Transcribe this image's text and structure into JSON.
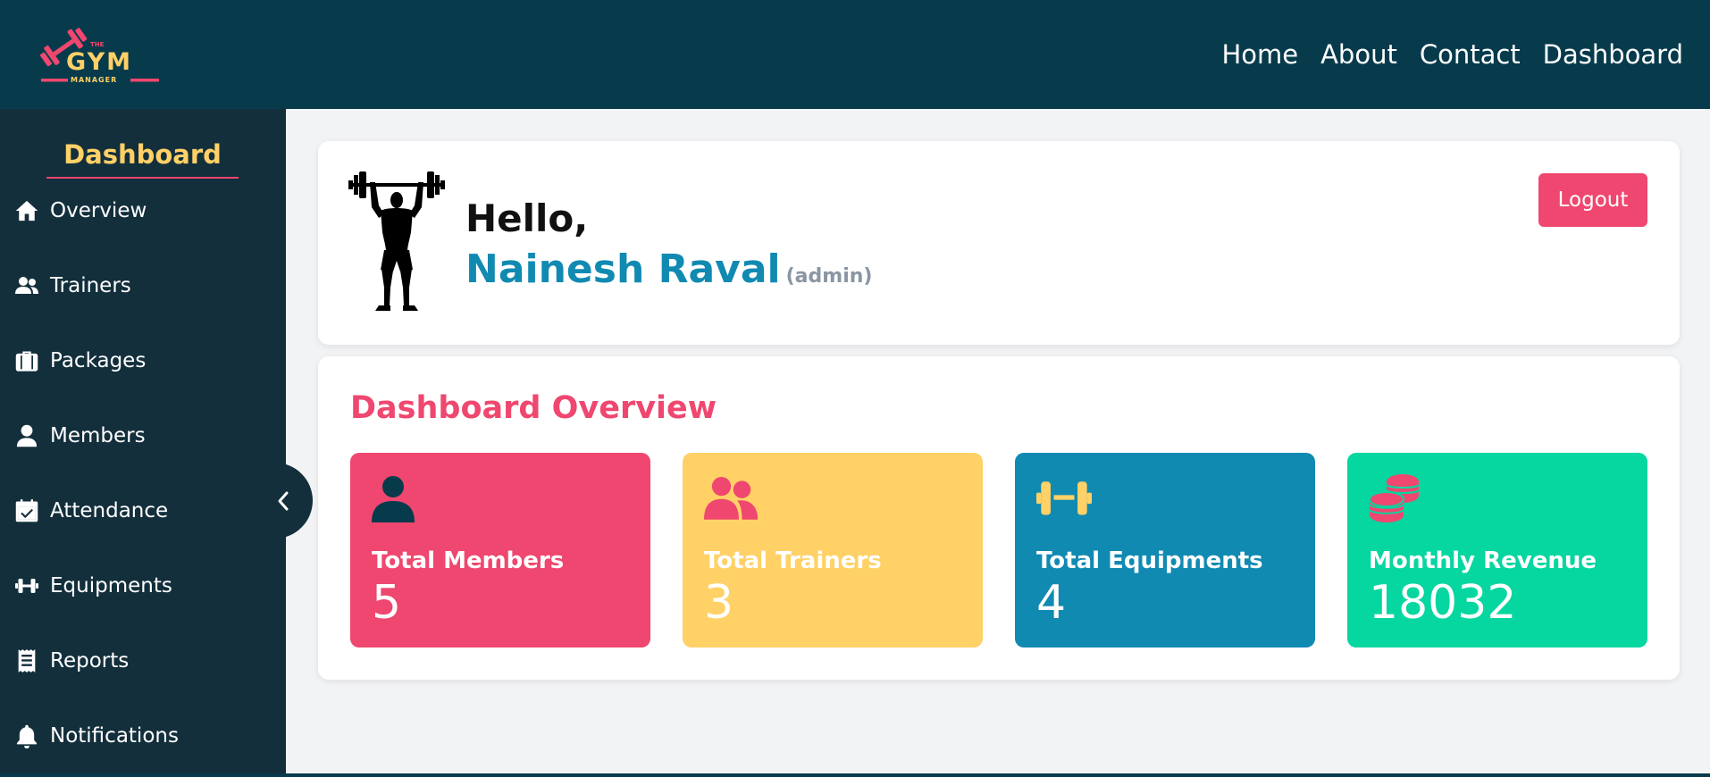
{
  "brand": {
    "logo_text_top": "THE",
    "logo_text_main": "GYM",
    "logo_text_bottom": "MANAGER",
    "colors": {
      "navy": "#073b4c",
      "pink": "#ef476f",
      "yellow": "#ffd166",
      "blue": "#118ab2",
      "green": "#06d6a0"
    }
  },
  "nav": {
    "links": [
      "Home",
      "About",
      "Contact",
      "Dashboard"
    ]
  },
  "sidebar": {
    "title": "Dashboard",
    "items": [
      {
        "label": "Overview",
        "icon": "home-icon"
      },
      {
        "label": "Trainers",
        "icon": "users-icon"
      },
      {
        "label": "Packages",
        "icon": "suitcase-icon"
      },
      {
        "label": "Members",
        "icon": "user-icon"
      },
      {
        "label": "Attendance",
        "icon": "calendar-check-icon"
      },
      {
        "label": "Equipments",
        "icon": "dumbbell-icon"
      },
      {
        "label": "Reports",
        "icon": "receipt-icon"
      },
      {
        "label": "Notifications",
        "icon": "bell-icon"
      }
    ]
  },
  "greeting": {
    "hello": "Hello,",
    "name": "Nainesh Raval",
    "role": "(admin)",
    "logout_label": "Logout"
  },
  "overview": {
    "title": "Dashboard Overview",
    "stats": [
      {
        "label": "Total Members",
        "value": "5",
        "icon": "user-icon",
        "color": "#ef476f"
      },
      {
        "label": "Total Trainers",
        "value": "3",
        "icon": "users-icon",
        "color": "#ffd166"
      },
      {
        "label": "Total Equipments",
        "value": "4",
        "icon": "dumbbell-icon",
        "color": "#118ab2"
      },
      {
        "label": "Monthly Revenue",
        "value": "18032",
        "icon": "coins-icon",
        "color": "#06d6a0"
      }
    ]
  }
}
